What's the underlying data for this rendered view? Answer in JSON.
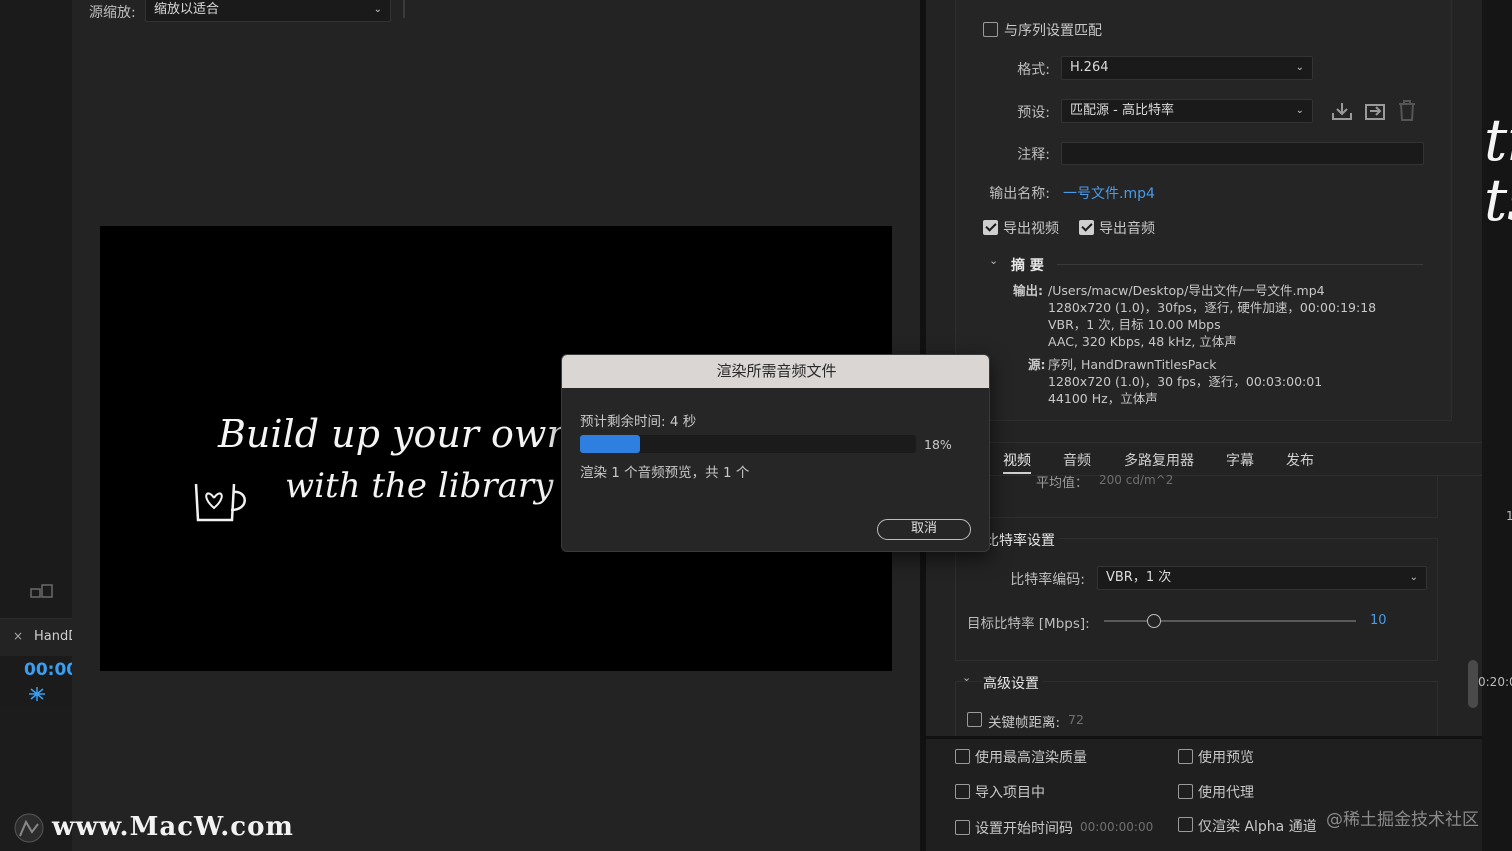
{
  "source": {
    "scale_label": "源缩放:",
    "scale_value": "缩放以适合",
    "timecode": "00:00",
    "sequence_tab": "HandD",
    "close_glyph": "×"
  },
  "preview": {
    "line1": "Build up your own",
    "line2": "with the library"
  },
  "export": {
    "match_sequence_label": "与序列设置匹配",
    "format_label": "格式:",
    "format_value": "H.264",
    "preset_label": "预设:",
    "preset_value": "匹配源 - 高比特率",
    "comments_label": "注释:",
    "comments_value": "",
    "output_name_label": "输出名称:",
    "output_name_value": "一号文件.mp4",
    "export_video_label": "导出视频",
    "export_audio_label": "导出音频",
    "summary_title": "摘 要",
    "summary_output_label": "输出:",
    "summary_output_lines": [
      "/Users/macw/Desktop/导出文件/一号文件.mp4",
      "1280x720 (1.0)，30fps，逐行, 硬件加速，00:00:19:18",
      "VBR，1 次, 目标 10.00 Mbps",
      "AAC, 320 Kbps, 48  kHz, 立体声"
    ],
    "summary_source_label": "源:",
    "summary_source_lines": [
      "序列, HandDrawnTitlesPack",
      "1280x720 (1.0)，30 fps，逐行，00:03:00:01",
      "44100 Hz，立体声"
    ],
    "tabs": [
      "视频",
      "音频",
      "多路复用器",
      "字幕",
      "发布"
    ],
    "hdr_average_label": "平均值：",
    "hdr_average_value": "200 cd/m^2",
    "bitrate_section_title": "比特率设置",
    "bitrate_encoding_label": "比特率编码:",
    "bitrate_encoding_value": "VBR，1 次",
    "target_bitrate_label": "目标比特率 [Mbps]:",
    "target_bitrate_value": "10",
    "target_bitrate_fraction": 0.2,
    "advanced_title": "高级设置",
    "keyframe_label": "关键帧距离:",
    "keyframe_value": "72",
    "opt_max_quality": "使用最高渲染质量",
    "opt_use_previews": "使用预览",
    "opt_import_project": "导入项目中",
    "opt_use_proxies": "使用代理",
    "opt_start_timecode": "设置开始时间码",
    "opt_start_timecode_value": "00:00:00:00",
    "opt_alpha_only": "仅渲染 Alpha 通道"
  },
  "dialog": {
    "title": "渲染所需音频文件",
    "time_remaining": "预计剩余时间: 4 秒",
    "progress_percent": "18%",
    "progress_fraction": 0.18,
    "status": "渲染 1 个音频预览，共 1 个",
    "cancel_label": "取消"
  },
  "edge": {
    "right_number": "1",
    "right_timecode": "0:20:0"
  },
  "watermarks": {
    "left": "www.MacW.com",
    "right": "@稀土掘金技术社区"
  },
  "colors": {
    "accent_blue": "#2f7fe0",
    "link_blue": "#4a9be8",
    "panel_bg": "#232323"
  }
}
